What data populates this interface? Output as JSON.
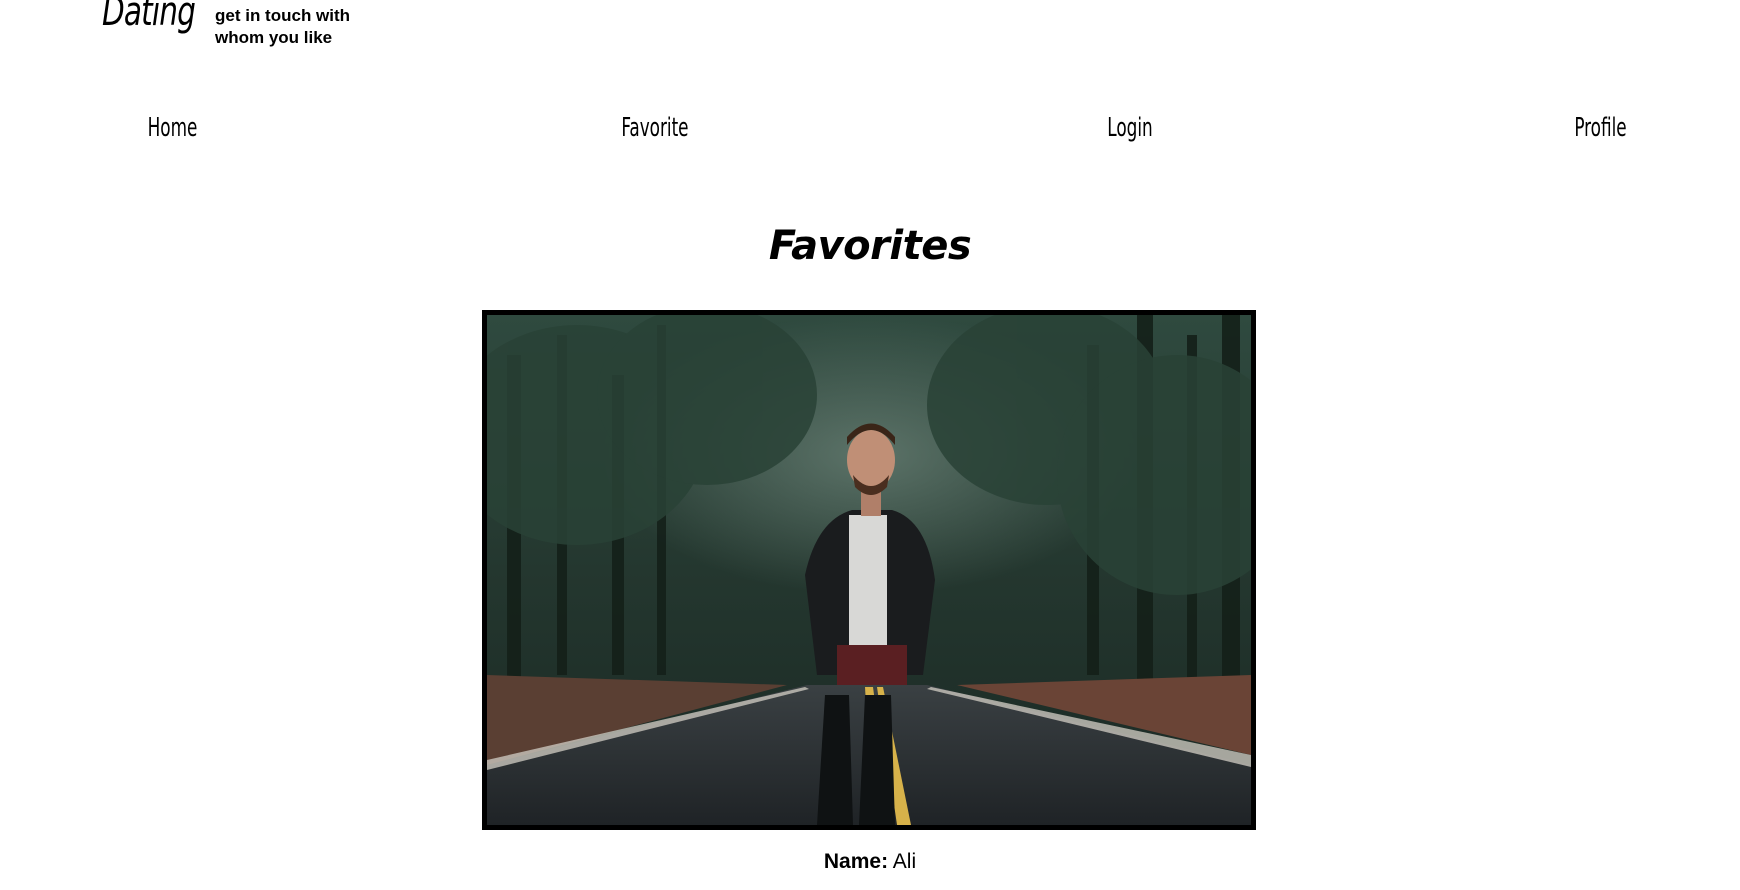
{
  "header": {
    "logo": "Dating",
    "tagline_line1": "get in touch with",
    "tagline_line2": "whom you like"
  },
  "nav": {
    "items": [
      {
        "label": "Home"
      },
      {
        "label": "Favorite"
      },
      {
        "label": "Login"
      },
      {
        "label": "Profile"
      }
    ]
  },
  "main": {
    "title": "Favorites",
    "favorites": [
      {
        "name_label": "Name:",
        "name_value": "Ali",
        "photo_description": "man-in-leather-jacket-on-forest-road"
      }
    ]
  }
}
